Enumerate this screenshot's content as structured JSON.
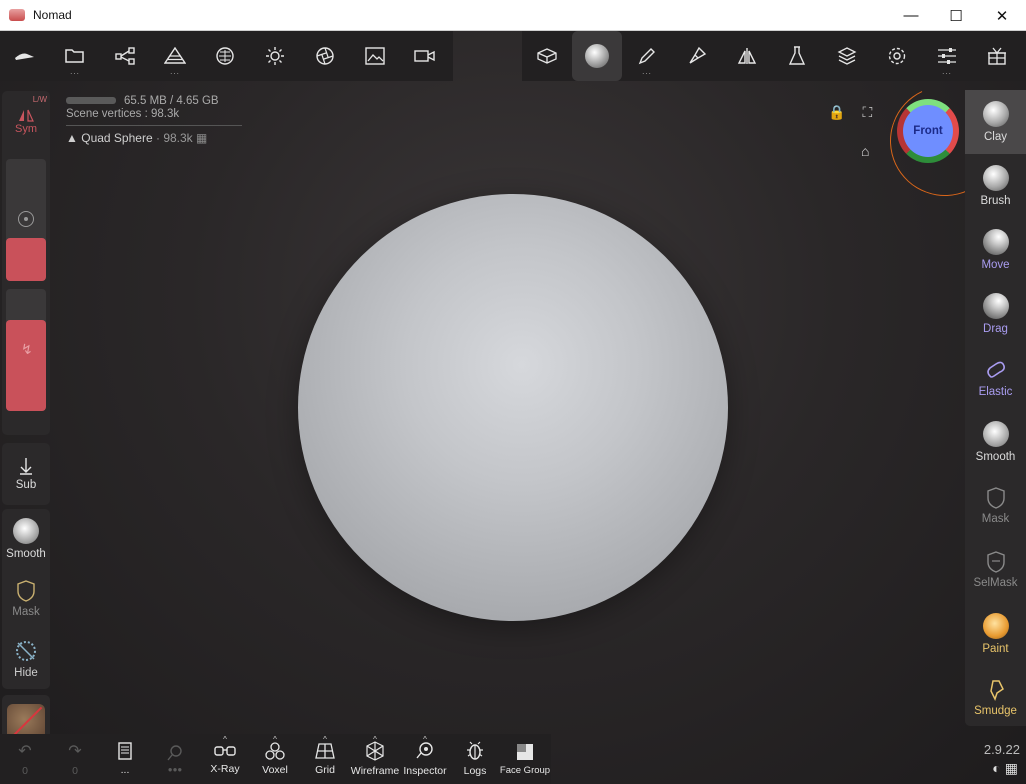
{
  "window": {
    "title": "Nomad",
    "buttons": [
      "minimize",
      "maximize",
      "close"
    ]
  },
  "toolbar_left": [
    {
      "name": "logo-icon",
      "dots": ""
    },
    {
      "name": "folder-icon",
      "dots": "..."
    },
    {
      "name": "scene-graph-icon",
      "dots": ""
    },
    {
      "name": "primitives-icon",
      "dots": "..."
    },
    {
      "name": "material-icon",
      "dots": ""
    },
    {
      "name": "light-icon",
      "dots": ""
    },
    {
      "name": "camera-aperture-icon",
      "dots": ""
    },
    {
      "name": "image-icon",
      "dots": ""
    },
    {
      "name": "video-icon",
      "dots": ""
    }
  ],
  "toolbar_right": [
    {
      "name": "box-icon",
      "dots": ""
    },
    {
      "name": "matcap-icon",
      "dots": ""
    },
    {
      "name": "pen-icon",
      "dots": "..."
    },
    {
      "name": "brush-icon",
      "dots": ""
    },
    {
      "name": "symmetry-icon",
      "dots": ""
    },
    {
      "name": "flask-icon",
      "dots": ""
    },
    {
      "name": "layers-icon",
      "dots": ""
    },
    {
      "name": "settings-icon",
      "dots": ""
    },
    {
      "name": "sliders-icon",
      "dots": "..."
    },
    {
      "name": "gift-icon",
      "dots": ""
    }
  ],
  "info": {
    "memory": "65.5 MB / 4.65 GB",
    "vertices": "Scene vertices : 98.3k",
    "mesh_name": "Quad Sphere",
    "mesh_vertices": "98.3k"
  },
  "left": {
    "sym_label": "Sym",
    "sym_badge": "L/W",
    "radius_fill": 0.5,
    "intensity_fill": 0.75,
    "sub_label": "Sub",
    "tools": [
      {
        "label": "Smooth",
        "icon": "smooth-icon",
        "color": "#dcdcdc"
      },
      {
        "label": "Mask",
        "icon": "mask-icon",
        "color": "#8a8a8a"
      },
      {
        "label": "Hide",
        "icon": "hide-icon",
        "color": "#cccccc"
      }
    ]
  },
  "gizmo": {
    "label": "Front"
  },
  "right_tools": [
    {
      "label": "Clay",
      "color": "#dcdcdc",
      "icon": "clay-icon"
    },
    {
      "label": "Brush",
      "color": "#dcdcdc",
      "icon": "brush-tool-icon"
    },
    {
      "label": "Move",
      "color": "#a99cf0",
      "icon": "move-icon"
    },
    {
      "label": "Drag",
      "color": "#a99cf0",
      "icon": "drag-icon"
    },
    {
      "label": "Elastic",
      "color": "#a99cf0",
      "icon": "elastic-icon"
    },
    {
      "label": "Smooth",
      "color": "#dcdcdc",
      "icon": "smooth-icon"
    },
    {
      "label": "Mask",
      "color": "#8a8a8a",
      "icon": "mask-icon"
    },
    {
      "label": "SelMask",
      "color": "#8a8a8a",
      "icon": "selmask-icon"
    },
    {
      "label": "Paint",
      "color": "#e8c46a",
      "icon": "paint-icon"
    },
    {
      "label": "Smudge",
      "color": "#e8c46a",
      "icon": "smudge-icon"
    }
  ],
  "bottom": [
    {
      "label": "",
      "icon": "undo-icon",
      "dim": true,
      "sub": "0"
    },
    {
      "label": "",
      "icon": "redo-icon",
      "dim": true,
      "sub": "0"
    },
    {
      "label": "...",
      "icon": "book-icon",
      "dim": false,
      "sub": ""
    },
    {
      "label": "",
      "icon": "search-icon",
      "dim": true,
      "sub": ""
    },
    {
      "label": "X-Ray",
      "icon": "xray-icon",
      "dim": false,
      "sub": "^"
    },
    {
      "label": "Voxel",
      "icon": "voxel-icon",
      "dim": false,
      "sub": "^"
    },
    {
      "label": "Grid",
      "icon": "grid-icon",
      "dim": false,
      "sub": "^"
    },
    {
      "label": "Wireframe",
      "icon": "wireframe-icon",
      "dim": false,
      "sub": "^"
    },
    {
      "label": "Inspector",
      "icon": "inspector-icon",
      "dim": false,
      "sub": "^"
    },
    {
      "label": "Logs",
      "icon": "bug-icon",
      "dim": false,
      "sub": ""
    },
    {
      "label": "Face Group",
      "icon": "facegroup-icon",
      "dim": false,
      "sub": ""
    }
  ],
  "version": "2.9.22"
}
